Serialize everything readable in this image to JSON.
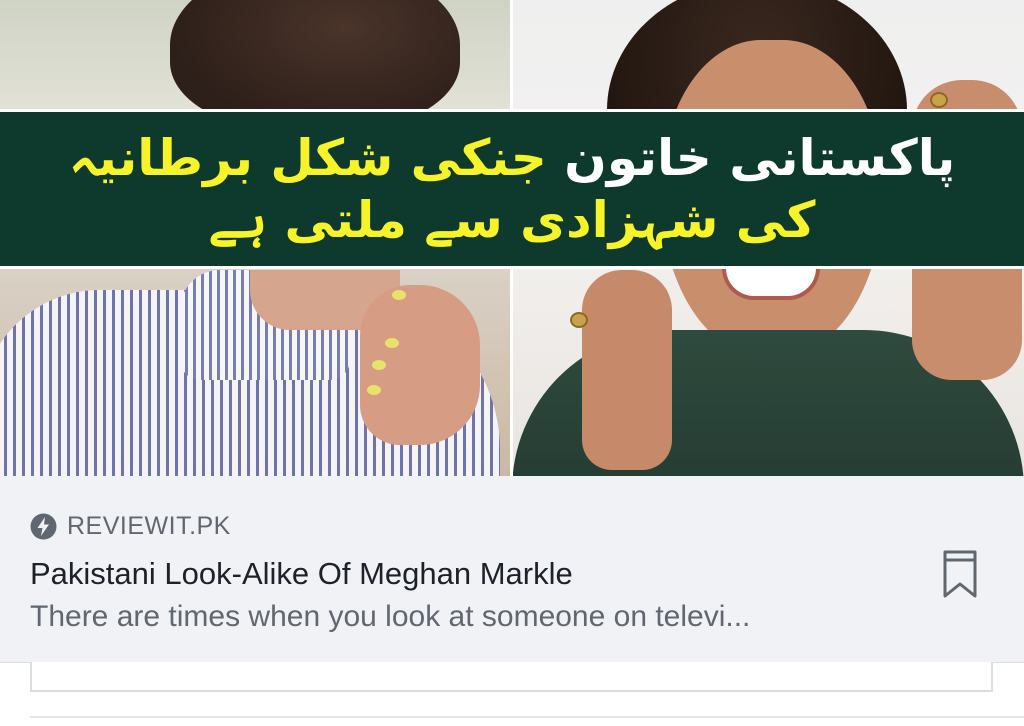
{
  "preview": {
    "headline_parts": [
      {
        "text": "پاکستانی خاتون ",
        "color": "#ffffff"
      },
      {
        "text": "جنکی شکل برطانیہ کی شہزادی سے ملتی ہے",
        "color": "#f7f32b"
      }
    ],
    "banner_color": "#0e3a2d"
  },
  "link": {
    "source_icon": "lightning-bolt-icon",
    "domain": "REVIEWIT.PK",
    "title": "Pakistani Look-Alike Of Meghan Markle",
    "description": "There are times when you look at someone on televi...",
    "bookmark_icon": "bookmark-icon"
  },
  "colors": {
    "meta_background": "#f1f2f6",
    "title_text": "#1d2129",
    "secondary_text": "#606770"
  }
}
